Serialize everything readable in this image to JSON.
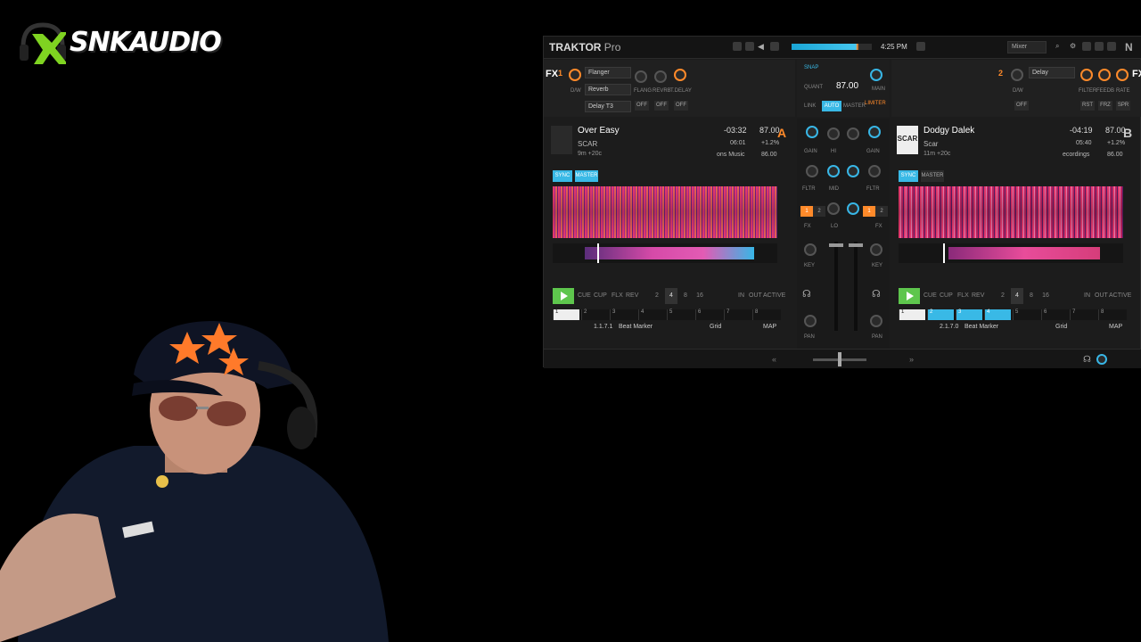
{
  "overlay": {
    "logo_text": "SNKAUDIO"
  },
  "app": {
    "brand": "TRAKTOR",
    "edition": "Pro",
    "time": "4:25 PM",
    "layout": "Mixer",
    "ni_logo": "N"
  },
  "fx": {
    "left": {
      "label": "FX",
      "unit": "1",
      "slots": [
        "Flanger",
        "Reverb",
        "Delay T3"
      ],
      "knob_labels": [
        "D/W",
        "FLANG",
        "REVRB",
        "T.DELAY"
      ],
      "buttons": [
        "OFF",
        "OFF",
        "OFF"
      ]
    },
    "right": {
      "label": "FX",
      "unit": "2",
      "slot": "Delay",
      "knob_labels": [
        "D/W",
        "FILTER",
        "FEEDB",
        "RATE"
      ],
      "buttons": [
        "OFF",
        "RST",
        "FRZ",
        "SPR"
      ]
    }
  },
  "master": {
    "snap": "SNAP",
    "quant": "QUANT",
    "tempo": "87.00",
    "link": "LINK",
    "auto": "AUTO",
    "master": "MASTER",
    "limiter": "LIMITER",
    "main": "MAIN"
  },
  "decks": [
    {
      "letter": "A",
      "title": "Over Easy",
      "artist": "SCAR",
      "length": "9m +20c",
      "remain": "-03:32",
      "elapsed": "06:01",
      "bpm": "87.00",
      "pitch": "+1.2%",
      "label": "ons Music",
      "key_bpm": "86.00",
      "sync": "SYNC",
      "master": "MASTER",
      "transport": [
        "CUE",
        "CUP",
        "FLX",
        "REV"
      ],
      "loops": [
        "2",
        "4",
        "8",
        "16"
      ],
      "loop_active": "4",
      "loop_ctrl": [
        "IN",
        "OUT",
        "ACTIVE"
      ],
      "beats": [
        "1",
        "2",
        "3",
        "4",
        "5",
        "6",
        "7",
        "8"
      ],
      "marker": "1.1.7.1",
      "marker_name": "Beat Marker",
      "grid": "Grid",
      "map": "MAP",
      "playhead_pct": 20
    },
    {
      "letter": "B",
      "title": "Dodgy Dalek",
      "artist": "Scar",
      "length": "11m +20c",
      "remain": "-04:19",
      "elapsed": "05:40",
      "bpm": "87.00",
      "pitch": "+1.2%",
      "label": "ecordings",
      "key_bpm": "86.00",
      "art_text": "SCAR",
      "sync": "SYNC",
      "master": "MASTER",
      "transport": [
        "CUE",
        "CUP",
        "FLX",
        "REV"
      ],
      "loops": [
        "2",
        "4",
        "8",
        "16"
      ],
      "loop_active": "4",
      "loop_ctrl": [
        "IN",
        "OUT",
        "ACTIVE"
      ],
      "beats": [
        "1",
        "2",
        "3",
        "4",
        "5",
        "6",
        "7",
        "8"
      ],
      "marker": "2.1.7.0",
      "marker_name": "Beat Marker",
      "grid": "Grid",
      "map": "MAP",
      "playhead_pct": 20
    }
  ],
  "mixer": {
    "gain": "GAIN",
    "hi": "HI",
    "mid": "MID",
    "lo": "LO",
    "filter": "FLTR",
    "fx": "FX",
    "key": "KEY",
    "pan": "PAN",
    "fx_assign": [
      "1",
      "2"
    ]
  }
}
